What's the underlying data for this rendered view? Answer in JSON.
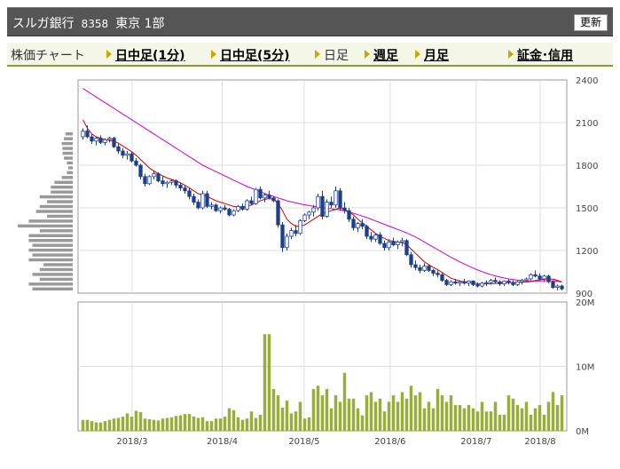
{
  "header": {
    "name": "スルガ銀行",
    "code": "8358",
    "market": "東京 1部",
    "refresh_label": "更新"
  },
  "menu": {
    "chart_label": "株価チャート",
    "items": [
      {
        "label": "日中足(1分)",
        "active": false
      },
      {
        "label": "日中足(5分)",
        "active": false
      },
      {
        "label": "日足",
        "active": true
      },
      {
        "label": "週足",
        "active": false
      },
      {
        "label": "月足",
        "active": false
      },
      {
        "label": "証金･信用",
        "active": false
      }
    ]
  },
  "colors": {
    "header_bg": "#555555",
    "candle_up": "#ffffff",
    "candle_down": "#1c3f8c",
    "ma_short": "#cc0000",
    "ma_long": "#cc00cc",
    "volume": "#99ad3a",
    "volume_profile": "#999999"
  },
  "chart_data": {
    "type": "candlestick",
    "price_axis": {
      "ticks": [
        "2400",
        "2100",
        "1800",
        "1500",
        "1200",
        "900"
      ],
      "ylim": [
        900,
        2400
      ]
    },
    "volume_axis": {
      "ticks": [
        "20M",
        "10M",
        "0M"
      ],
      "ylim": [
        0,
        20
      ]
    },
    "x_ticks": [
      "2018/3",
      "2018/4",
      "2018/5",
      "2018/6",
      "2018/7",
      "2018/8"
    ],
    "candles": [
      [
        2000,
        2060,
        1980,
        2040
      ],
      [
        2040,
        2080,
        1990,
        2000
      ],
      [
        2000,
        2020,
        1950,
        1970
      ],
      [
        1970,
        2000,
        1940,
        1990
      ],
      [
        1990,
        2010,
        1950,
        1960
      ],
      [
        1960,
        1990,
        1940,
        1980
      ],
      [
        1980,
        2000,
        1960,
        1990
      ],
      [
        1990,
        2000,
        1920,
        1930
      ],
      [
        1930,
        1950,
        1880,
        1900
      ],
      [
        1900,
        1920,
        1850,
        1870
      ],
      [
        1870,
        1900,
        1840,
        1880
      ],
      [
        1880,
        1890,
        1820,
        1830
      ],
      [
        1830,
        1850,
        1790,
        1800
      ],
      [
        1800,
        1810,
        1700,
        1720
      ],
      [
        1720,
        1740,
        1650,
        1670
      ],
      [
        1670,
        1730,
        1660,
        1720
      ],
      [
        1720,
        1760,
        1700,
        1740
      ],
      [
        1740,
        1750,
        1680,
        1690
      ],
      [
        1690,
        1720,
        1650,
        1670
      ],
      [
        1670,
        1690,
        1640,
        1680
      ],
      [
        1680,
        1700,
        1660,
        1690
      ],
      [
        1690,
        1700,
        1640,
        1660
      ],
      [
        1660,
        1680,
        1620,
        1640
      ],
      [
        1640,
        1660,
        1600,
        1620
      ],
      [
        1620,
        1640,
        1560,
        1580
      ],
      [
        1580,
        1600,
        1520,
        1540
      ],
      [
        1540,
        1560,
        1490,
        1500
      ],
      [
        1500,
        1620,
        1490,
        1600
      ],
      [
        1600,
        1620,
        1500,
        1510
      ],
      [
        1510,
        1540,
        1490,
        1520
      ],
      [
        1520,
        1530,
        1470,
        1480
      ],
      [
        1480,
        1510,
        1460,
        1500
      ],
      [
        1500,
        1520,
        1480,
        1490
      ],
      [
        1490,
        1500,
        1440,
        1450
      ],
      [
        1450,
        1490,
        1440,
        1480
      ],
      [
        1480,
        1520,
        1470,
        1510
      ],
      [
        1510,
        1530,
        1480,
        1490
      ],
      [
        1490,
        1560,
        1480,
        1550
      ],
      [
        1550,
        1580,
        1520,
        1530
      ],
      [
        1530,
        1640,
        1520,
        1630
      ],
      [
        1630,
        1650,
        1560,
        1570
      ],
      [
        1570,
        1600,
        1540,
        1590
      ],
      [
        1590,
        1620,
        1560,
        1570
      ],
      [
        1570,
        1580,
        1540,
        1550
      ],
      [
        1550,
        1560,
        1360,
        1380
      ],
      [
        1380,
        1400,
        1190,
        1220
      ],
      [
        1220,
        1320,
        1200,
        1300
      ],
      [
        1300,
        1360,
        1280,
        1340
      ],
      [
        1340,
        1380,
        1300,
        1320
      ],
      [
        1320,
        1420,
        1310,
        1410
      ],
      [
        1410,
        1460,
        1400,
        1450
      ],
      [
        1450,
        1480,
        1420,
        1470
      ],
      [
        1470,
        1520,
        1440,
        1500
      ],
      [
        1500,
        1600,
        1480,
        1580
      ],
      [
        1580,
        1620,
        1420,
        1440
      ],
      [
        1440,
        1560,
        1430,
        1540
      ],
      [
        1540,
        1580,
        1500,
        1520
      ],
      [
        1520,
        1650,
        1500,
        1620
      ],
      [
        1620,
        1640,
        1480,
        1500
      ],
      [
        1500,
        1540,
        1460,
        1480
      ],
      [
        1480,
        1500,
        1400,
        1420
      ],
      [
        1420,
        1440,
        1340,
        1360
      ],
      [
        1360,
        1400,
        1330,
        1390
      ],
      [
        1390,
        1420,
        1350,
        1370
      ],
      [
        1370,
        1380,
        1280,
        1300
      ],
      [
        1300,
        1330,
        1260,
        1280
      ],
      [
        1280,
        1320,
        1260,
        1310
      ],
      [
        1310,
        1330,
        1240,
        1250
      ],
      [
        1250,
        1270,
        1200,
        1220
      ],
      [
        1220,
        1280,
        1200,
        1260
      ],
      [
        1260,
        1290,
        1230,
        1240
      ],
      [
        1240,
        1270,
        1210,
        1260
      ],
      [
        1260,
        1290,
        1230,
        1270
      ],
      [
        1270,
        1280,
        1160,
        1170
      ],
      [
        1170,
        1190,
        1080,
        1100
      ],
      [
        1100,
        1130,
        1060,
        1080
      ],
      [
        1080,
        1100,
        1040,
        1060
      ],
      [
        1060,
        1110,
        1050,
        1090
      ],
      [
        1090,
        1100,
        1050,
        1060
      ],
      [
        1060,
        1070,
        1020,
        1040
      ],
      [
        1040,
        1060,
        1010,
        1030
      ],
      [
        1030,
        1040,
        980,
        990
      ],
      [
        990,
        1000,
        950,
        960
      ],
      [
        960,
        990,
        950,
        980
      ],
      [
        980,
        1000,
        960,
        970
      ],
      [
        970,
        990,
        950,
        980
      ],
      [
        980,
        1000,
        960,
        970
      ],
      [
        970,
        990,
        950,
        985
      ],
      [
        985,
        990,
        950,
        960
      ],
      [
        960,
        975,
        940,
        950
      ],
      [
        950,
        980,
        940,
        970
      ],
      [
        970,
        990,
        950,
        975
      ],
      [
        975,
        1000,
        960,
        990
      ],
      [
        990,
        1010,
        970,
        980
      ],
      [
        980,
        990,
        950,
        965
      ],
      [
        965,
        990,
        950,
        985
      ],
      [
        985,
        1000,
        960,
        975
      ],
      [
        975,
        990,
        950,
        960
      ],
      [
        960,
        990,
        950,
        980
      ],
      [
        980,
        1000,
        960,
        990
      ],
      [
        990,
        1010,
        980,
        1000
      ],
      [
        1000,
        1040,
        990,
        1030
      ],
      [
        1030,
        1060,
        1010,
        1020
      ],
      [
        1020,
        1040,
        990,
        1000
      ],
      [
        1000,
        1030,
        980,
        1020
      ],
      [
        1020,
        1030,
        970,
        980
      ],
      [
        980,
        990,
        930,
        940
      ],
      [
        940,
        960,
        920,
        950
      ],
      [
        950,
        960,
        920,
        930
      ]
    ],
    "ma_short": [
      2120,
      2060,
      2020,
      2000,
      1990,
      1980,
      1975,
      1970,
      1955,
      1935,
      1915,
      1895,
      1870,
      1840,
      1810,
      1780,
      1760,
      1740,
      1725,
      1710,
      1700,
      1690,
      1675,
      1660,
      1640,
      1620,
      1600,
      1590,
      1580,
      1565,
      1550,
      1540,
      1530,
      1520,
      1510,
      1505,
      1505,
      1510,
      1520,
      1535,
      1550,
      1560,
      1565,
      1560,
      1530,
      1480,
      1420,
      1390,
      1370,
      1370,
      1380,
      1400,
      1420,
      1440,
      1460,
      1470,
      1480,
      1490,
      1500,
      1490,
      1470,
      1450,
      1420,
      1395,
      1370,
      1345,
      1320,
      1300,
      1285,
      1270,
      1265,
      1260,
      1255,
      1240,
      1210,
      1180,
      1150,
      1120,
      1100,
      1080,
      1065,
      1045,
      1025,
      1005,
      995,
      985,
      980,
      975,
      970,
      967,
      965,
      965,
      966,
      968,
      970,
      972,
      974,
      975,
      975,
      976,
      978,
      982,
      988,
      994,
      998,
      1000,
      998,
      990,
      978
    ],
    "ma_long": [
      2340,
      2320,
      2300,
      2280,
      2260,
      2240,
      2220,
      2200,
      2180,
      2160,
      2140,
      2120,
      2100,
      2080,
      2060,
      2040,
      2020,
      2000,
      1980,
      1960,
      1940,
      1920,
      1900,
      1880,
      1860,
      1840,
      1820,
      1800,
      1785,
      1770,
      1755,
      1740,
      1725,
      1710,
      1695,
      1680,
      1665,
      1650,
      1638,
      1626,
      1614,
      1602,
      1590,
      1580,
      1570,
      1560,
      1550,
      1542,
      1535,
      1528,
      1522,
      1516,
      1511,
      1506,
      1502,
      1498,
      1494,
      1490,
      1486,
      1480,
      1472,
      1462,
      1452,
      1442,
      1432,
      1420,
      1408,
      1396,
      1384,
      1372,
      1360,
      1348,
      1336,
      1324,
      1310,
      1295,
      1278,
      1260,
      1242,
      1224,
      1206,
      1188,
      1170,
      1152,
      1136,
      1120,
      1105,
      1090,
      1076,
      1063,
      1051,
      1040,
      1030,
      1021,
      1013,
      1006,
      1000,
      995,
      991,
      988,
      986,
      985,
      985,
      986,
      987,
      988,
      987,
      984,
      978
    ],
    "volumes": [
      1.7,
      1.7,
      1.5,
      1.3,
      1.3,
      1.5,
      1.7,
      1.9,
      2.0,
      2.2,
      2.7,
      2.2,
      3.1,
      2.9,
      1.9,
      1.8,
      1.7,
      1.6,
      1.9,
      2.0,
      2.1,
      2.3,
      2.4,
      2.6,
      2.6,
      2.2,
      2.0,
      2.1,
      1.5,
      1.5,
      1.9,
      1.9,
      2.2,
      3.5,
      3.2,
      2.1,
      1.7,
      1.9,
      3.0,
      2.0,
      2.5,
      15.0,
      15.0,
      6.5,
      5.5,
      3.6,
      4.7,
      2.7,
      3.0,
      4.5,
      1.9,
      2.1,
      6.5,
      7.0,
      5.5,
      6.5,
      3.5,
      5.5,
      4.5,
      9.0,
      5.0,
      5.0,
      3.5,
      2.4,
      5.5,
      6.0,
      4.5,
      5.0,
      3.0,
      4.5,
      5.5,
      4.5,
      6.0,
      5.0,
      7.0,
      5.5,
      6.0,
      3.5,
      4.5,
      3.5,
      6.5,
      5.5,
      4.5,
      5.5,
      4.0,
      4.0,
      3.5,
      4.0,
      3.5,
      3.0,
      4.5,
      3.0,
      3.0,
      4.5,
      2.5,
      2.5,
      5.5,
      5.0,
      4.0,
      3.5,
      4.5,
      2.5,
      3.5,
      4.0,
      2.5,
      4.5,
      6.0,
      4.0,
      5.5,
      5.0,
      3.5,
      4.0,
      3.0,
      4.0,
      4.0,
      3.0
    ],
    "volume_profile": [
      5.5,
      6.0,
      4.5,
      5.5,
      4.5,
      4.0,
      6.0,
      5.5,
      6.0,
      5.5,
      6.0,
      6.0,
      4.5,
      7.5,
      6.0,
      3.5,
      5.0,
      4.5,
      3.5,
      4.5,
      3.0,
      3.0,
      2.5,
      1.5,
      0.8,
      0.6,
      0.8,
      1.2,
      1.4,
      1.4,
      1.5,
      1.2,
      1.0
    ]
  }
}
